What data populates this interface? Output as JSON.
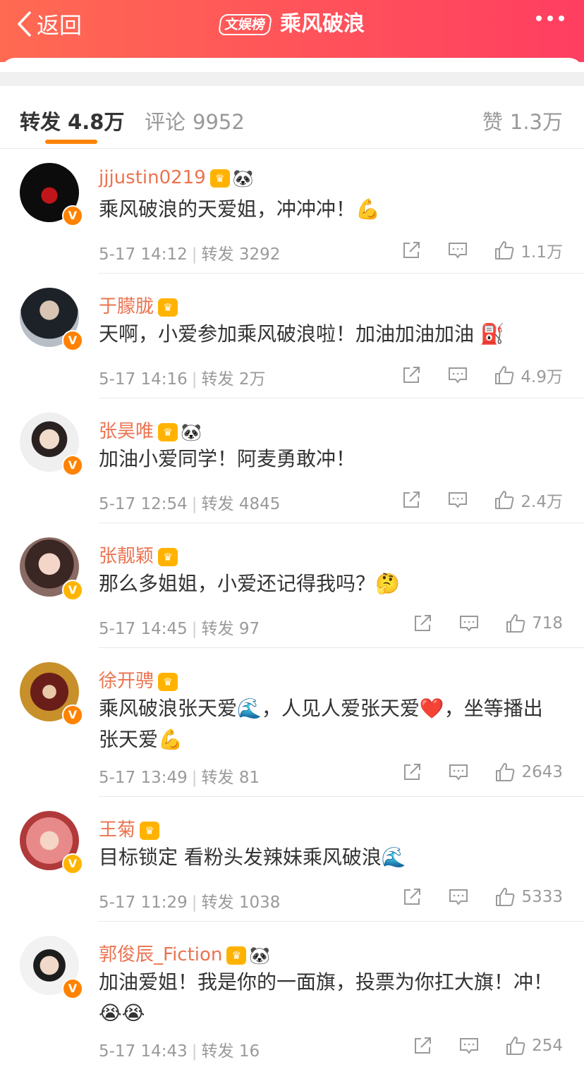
{
  "header": {
    "back_label": "返回",
    "badge": "文娱榜",
    "title": "乘风破浪"
  },
  "tabs": {
    "repost": {
      "label": "转发",
      "count": "4.8万"
    },
    "comment": {
      "label": "评论",
      "count": "9952"
    },
    "like": {
      "label": "赞",
      "count": "1.3万"
    }
  },
  "posts": [
    {
      "name": "jjjustin0219",
      "content": "乘风破浪的天爱姐，冲冲冲！💪",
      "time": "5-17 14:12",
      "repost_label": "转发",
      "repost_count": "3292",
      "likes": "1.1万",
      "v_color": "#ff8200"
    },
    {
      "name": "于朦胧",
      "content": "天啊，小爱参加乘风破浪啦！加油加油加油 ⛽",
      "time": "5-17 14:16",
      "repost_label": "转发",
      "repost_count": "2万",
      "likes": "4.9万",
      "v_color": "#ff8200"
    },
    {
      "name": "张昊唯",
      "content": "加油小爱同学！阿麦勇敢冲！",
      "time": "5-17 12:54",
      "repost_label": "转发",
      "repost_count": "4845",
      "likes": "2.4万",
      "v_color": "#ff8200"
    },
    {
      "name": "张靓颖",
      "content": "那么多姐姐，小爱还记得我吗？🤔",
      "time": "5-17 14:45",
      "repost_label": "转发",
      "repost_count": "97",
      "likes": "718",
      "v_color": "#ffb400"
    },
    {
      "name": "徐开骋",
      "content": "乘风破浪张天爱🌊，人见人爱张天爱❤️，坐等播出张天爱💪",
      "time": "5-17 13:49",
      "repost_label": "转发",
      "repost_count": "81",
      "likes": "2643",
      "v_color": "#ff8200"
    },
    {
      "name": "王菊",
      "content": "目标锁定 看粉头发辣妹乘风破浪🌊",
      "time": "5-17 11:29",
      "repost_label": "转发",
      "repost_count": "1038",
      "likes": "5333",
      "v_color": "#ffb400"
    },
    {
      "name": "郭俊辰_Fiction",
      "content": "加油爱姐！我是你的一面旗，投票为你扛大旗！冲！😭😭",
      "time": "5-17 14:43",
      "repost_label": "转发",
      "repost_count": "16",
      "likes": "254",
      "v_color": "#ff8200"
    }
  ],
  "icons": {
    "back": "chevron-left-icon",
    "more": "more-dots-icon",
    "repost": "share-icon",
    "comment": "comment-icon",
    "like": "thumbs-up-icon",
    "crown": "crown-icon",
    "panda": "panda-icon",
    "verified": "verified-v-icon"
  },
  "colors": {
    "header_start": "#ff6a52",
    "header_end": "#ff3e61",
    "name": "#eb7350",
    "accent": "#ff8200"
  }
}
